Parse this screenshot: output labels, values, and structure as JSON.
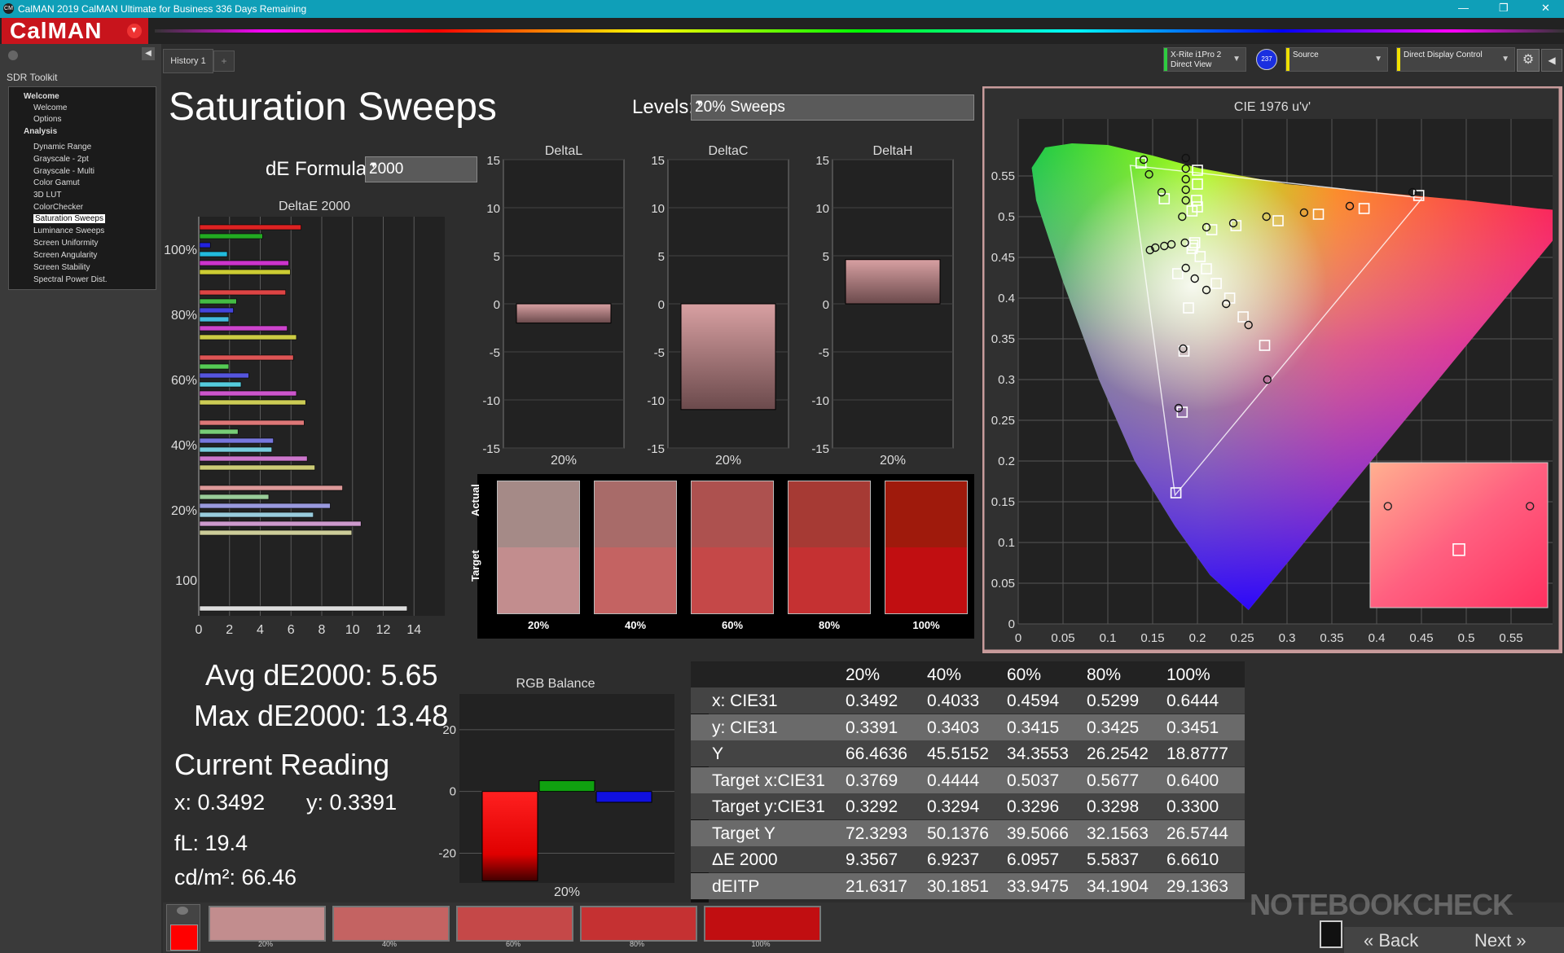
{
  "window": {
    "title": "CalMAN 2019 CalMAN Ultimate for Business 336 Days Remaining",
    "logo": "CM",
    "min": "—",
    "max": "❐",
    "close": "✕"
  },
  "brand": {
    "label": "CalMAN"
  },
  "sidebar": {
    "title": "SDR Toolkit",
    "items": [
      {
        "label": "Welcome",
        "type": "header"
      },
      {
        "label": "Welcome",
        "type": "item"
      },
      {
        "label": "Options",
        "type": "item"
      },
      {
        "label": "Analysis",
        "type": "header"
      },
      {
        "label": "Dynamic Range",
        "type": "item"
      },
      {
        "label": "Grayscale - 2pt",
        "type": "item"
      },
      {
        "label": "Grayscale - Multi",
        "type": "item"
      },
      {
        "label": "Color Gamut",
        "type": "item"
      },
      {
        "label": "3D LUT",
        "type": "item"
      },
      {
        "label": "ColorChecker",
        "type": "item"
      },
      {
        "label": "Saturation Sweeps",
        "type": "selected"
      },
      {
        "label": "Luminance Sweeps",
        "type": "item"
      },
      {
        "label": "Screen Uniformity",
        "type": "item"
      },
      {
        "label": "Screen Angularity",
        "type": "item"
      },
      {
        "label": "Screen Stability",
        "type": "item"
      },
      {
        "label": "Spectral Power Dist.",
        "type": "item"
      }
    ]
  },
  "tabs": {
    "history": "History 1",
    "add": "+"
  },
  "devices": {
    "meter_line1": "X-Rite i1Pro 2",
    "meter_line2": "Direct View",
    "badge": "237",
    "source": "Source",
    "display": "Direct Display Control",
    "meter_color": "#2ecc40",
    "source_color": "#f0e000",
    "display_color": "#f0e000"
  },
  "page": {
    "title": "Saturation Sweeps",
    "levels_label": "Levels:",
    "levels_value": "20% Sweeps",
    "de_label": "dE Formula:",
    "de_value": "2000"
  },
  "deltae_chart": {
    "title": "DeltaE 2000",
    "x_ticks": [
      "0",
      "2",
      "4",
      "6",
      "8",
      "10",
      "12",
      "14"
    ],
    "groups": [
      {
        "label": "100%",
        "bars": [
          {
            "v": 6.6,
            "c": "#d22"
          },
          {
            "v": 4.1,
            "c": "#2a2"
          },
          {
            "v": 0.7,
            "c": "#22d"
          },
          {
            "v": 1.8,
            "c": "#2bd"
          },
          {
            "v": 5.8,
            "c": "#c3c"
          },
          {
            "v": 5.9,
            "c": "#cc3"
          }
        ]
      },
      {
        "label": "80%",
        "bars": [
          {
            "v": 5.6,
            "c": "#d44"
          },
          {
            "v": 2.4,
            "c": "#4b4"
          },
          {
            "v": 2.2,
            "c": "#44d"
          },
          {
            "v": 1.9,
            "c": "#4bd"
          },
          {
            "v": 5.7,
            "c": "#c4c"
          },
          {
            "v": 6.3,
            "c": "#cc4"
          }
        ]
      },
      {
        "label": "60%",
        "bars": [
          {
            "v": 6.1,
            "c": "#d55"
          },
          {
            "v": 1.9,
            "c": "#5c5"
          },
          {
            "v": 3.2,
            "c": "#55d"
          },
          {
            "v": 2.7,
            "c": "#5cd"
          },
          {
            "v": 6.3,
            "c": "#c5c"
          },
          {
            "v": 6.9,
            "c": "#cc5"
          }
        ]
      },
      {
        "label": "40%",
        "bars": [
          {
            "v": 6.8,
            "c": "#d77"
          },
          {
            "v": 2.5,
            "c": "#7c7"
          },
          {
            "v": 4.8,
            "c": "#77d"
          },
          {
            "v": 4.7,
            "c": "#7cd"
          },
          {
            "v": 7.0,
            "c": "#c7c"
          },
          {
            "v": 7.5,
            "c": "#cc7"
          }
        ]
      },
      {
        "label": "20%",
        "bars": [
          {
            "v": 9.3,
            "c": "#d99"
          },
          {
            "v": 4.5,
            "c": "#9c9"
          },
          {
            "v": 8.5,
            "c": "#99d"
          },
          {
            "v": 7.4,
            "c": "#9cd"
          },
          {
            "v": 10.5,
            "c": "#c9c"
          },
          {
            "v": 9.9,
            "c": "#cc9"
          }
        ]
      },
      {
        "label": "100",
        "bars": [
          {
            "v": 13.5,
            "c": "#ddd"
          }
        ]
      }
    ]
  },
  "delta_small": [
    {
      "title": "DeltaL",
      "value": -2.0,
      "xlabel": "20%"
    },
    {
      "title": "DeltaC",
      "value": -11.0,
      "xlabel": "20%"
    },
    {
      "title": "DeltaH",
      "value": 4.6,
      "xlabel": "20%"
    }
  ],
  "delta_yticks": [
    "15",
    "10",
    "5",
    "0",
    "-5",
    "-10",
    "-15"
  ],
  "swatch_strip": {
    "actual_label": "Actual",
    "target_label": "Target",
    "items": [
      {
        "label": "20%",
        "actual": "#a58a87",
        "target": "#c28d8e"
      },
      {
        "label": "40%",
        "actual": "#a86b69",
        "target": "#c46362"
      },
      {
        "label": "60%",
        "actual": "#ad514f",
        "target": "#c54848"
      },
      {
        "label": "80%",
        "actual": "#a63a34",
        "target": "#c53132"
      },
      {
        "label": "100%",
        "actual": "#9f1a0c",
        "target": "#c10e11"
      }
    ]
  },
  "cie": {
    "title": "CIE 1976 u'v'",
    "x_ticks": [
      "0",
      "0.05",
      "0.1",
      "0.15",
      "0.2",
      "0.25",
      "0.3",
      "0.35",
      "0.4",
      "0.45",
      "0.5",
      "0.55"
    ],
    "y_ticks": [
      "0",
      "0.05",
      "0.1",
      "0.15",
      "0.2",
      "0.25",
      "0.3",
      "0.35",
      "0.4",
      "0.45",
      "0.5",
      "0.55"
    ],
    "target_points": [
      [
        0.197,
        0.468
      ],
      [
        0.203,
        0.451
      ],
      [
        0.21,
        0.436
      ],
      [
        0.221,
        0.418
      ],
      [
        0.236,
        0.4
      ],
      [
        0.251,
        0.377
      ],
      [
        0.275,
        0.342
      ],
      [
        0.195,
        0.465
      ],
      [
        0.194,
        0.461
      ],
      [
        0.216,
        0.484
      ],
      [
        0.243,
        0.489
      ],
      [
        0.29,
        0.495
      ],
      [
        0.335,
        0.503
      ],
      [
        0.386,
        0.51
      ],
      [
        0.447,
        0.526
      ],
      [
        0.194,
        0.507
      ],
      [
        0.2,
        0.512
      ],
      [
        0.199,
        0.52
      ],
      [
        0.2,
        0.54
      ],
      [
        0.2,
        0.557
      ],
      [
        0.163,
        0.522
      ],
      [
        0.137,
        0.566
      ],
      [
        0.178,
        0.43
      ],
      [
        0.19,
        0.388
      ],
      [
        0.185,
        0.335
      ],
      [
        0.183,
        0.26
      ],
      [
        0.176,
        0.161
      ]
    ],
    "actual_points": [
      [
        0.186,
        0.468
      ],
      [
        0.171,
        0.466
      ],
      [
        0.163,
        0.464
      ],
      [
        0.153,
        0.462
      ],
      [
        0.147,
        0.459
      ],
      [
        0.183,
        0.5
      ],
      [
        0.21,
        0.487
      ],
      [
        0.24,
        0.492
      ],
      [
        0.277,
        0.5
      ],
      [
        0.319,
        0.505
      ],
      [
        0.37,
        0.513
      ],
      [
        0.44,
        0.53
      ],
      [
        0.187,
        0.52
      ],
      [
        0.187,
        0.533
      ],
      [
        0.187,
        0.546
      ],
      [
        0.187,
        0.559
      ],
      [
        0.187,
        0.572
      ],
      [
        0.16,
        0.53
      ],
      [
        0.146,
        0.552
      ],
      [
        0.14,
        0.57
      ],
      [
        0.187,
        0.437
      ],
      [
        0.197,
        0.424
      ],
      [
        0.21,
        0.41
      ],
      [
        0.232,
        0.393
      ],
      [
        0.257,
        0.367
      ],
      [
        0.278,
        0.3
      ],
      [
        0.184,
        0.338
      ],
      [
        0.179,
        0.265
      ]
    ],
    "inset_actual": [
      [
        0.1,
        0.3
      ],
      [
        0.9,
        0.3
      ]
    ],
    "inset_target": [
      [
        0.5,
        0.6
      ]
    ]
  },
  "stats": {
    "avg": "Avg dE2000: 5.65",
    "max": "Max dE2000: 13.48",
    "current": "Current Reading",
    "x": "x: 0.3492",
    "y": "y: 0.3391",
    "fl": "fL: 19.4",
    "cd": "cd/m²: 66.46"
  },
  "rgb_balance": {
    "title": "RGB Balance",
    "xlabel": "20%",
    "y_ticks": [
      "20",
      "0",
      "-20"
    ],
    "r": -29,
    "g": 3.5,
    "b": -3.5
  },
  "table": {
    "headers": [
      "",
      "20%",
      "40%",
      "60%",
      "80%",
      "100%"
    ],
    "rows": [
      [
        "x: CIE31",
        "0.3492",
        "0.4033",
        "0.4594",
        "0.5299",
        "0.6444"
      ],
      [
        "y: CIE31",
        "0.3391",
        "0.3403",
        "0.3415",
        "0.3425",
        "0.3451"
      ],
      [
        "Y",
        "66.4636",
        "45.5152",
        "34.3553",
        "26.2542",
        "18.8777"
      ],
      [
        "Target x:CIE31",
        "0.3769",
        "0.4444",
        "0.5037",
        "0.5677",
        "0.6400"
      ],
      [
        "Target y:CIE31",
        "0.3292",
        "0.3294",
        "0.3296",
        "0.3298",
        "0.3300"
      ],
      [
        "Target Y",
        "72.3293",
        "50.1376",
        "39.5066",
        "32.1563",
        "26.5744"
      ],
      [
        "ΔE 2000",
        "9.3567",
        "6.9237",
        "6.0957",
        "5.5837",
        "6.6610"
      ],
      [
        "dEITP",
        "21.6317",
        "30.1851",
        "33.9475",
        "34.1904",
        "29.1363"
      ]
    ]
  },
  "bottom": {
    "swatches": [
      {
        "label": "20%",
        "color": "#c28d8e"
      },
      {
        "label": "40%",
        "color": "#c46362"
      },
      {
        "label": "60%",
        "color": "#c54848"
      },
      {
        "label": "80%",
        "color": "#c53132"
      },
      {
        "label": "100%",
        "color": "#c10e11"
      }
    ],
    "current_color": "#ff0000",
    "back": "Back",
    "next": "Next"
  },
  "watermark": "NOTEBOOKCHECK"
}
